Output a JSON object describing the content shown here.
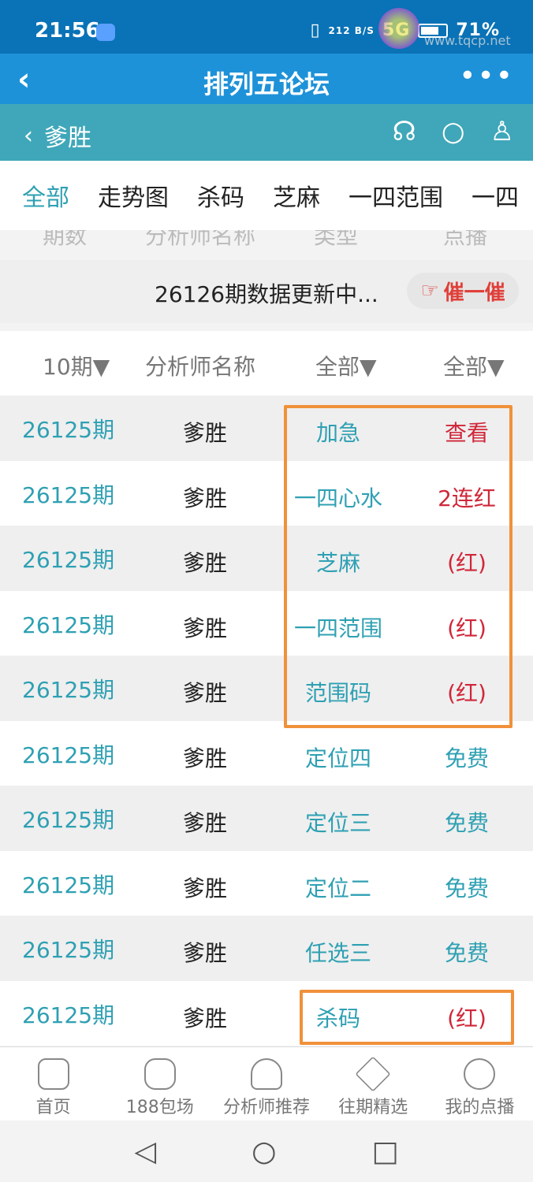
{
  "status": {
    "time": "21:56",
    "network": "212 B/S",
    "signal": "5G",
    "battery": "71%"
  },
  "header": {
    "title": "排列五论坛",
    "back_icon": "chevron-left-icon",
    "more_icon": "more-icon"
  },
  "subheader": {
    "name": "爹胜",
    "icons": [
      "headset-icon",
      "search-icon",
      "user-icon"
    ]
  },
  "tabs": [
    "全部",
    "走势图",
    "杀码",
    "芝麻",
    "一四范围",
    "一四"
  ],
  "ghost_header": [
    "期数",
    "分析师名称",
    "类型",
    "点播"
  ],
  "notice": {
    "text": "26126期数据更新中...",
    "urge_label": "催一催"
  },
  "filters": {
    "period": "10期▼",
    "analyst": "分析师名称",
    "type": "全部▼",
    "status": "全部▼"
  },
  "rows": [
    {
      "period": "26125期",
      "analyst": "爹胜",
      "type": "加急",
      "status": "查看",
      "red": true
    },
    {
      "period": "26125期",
      "analyst": "爹胜",
      "type": "一四心水",
      "status": "2连红",
      "red": true
    },
    {
      "period": "26125期",
      "analyst": "爹胜",
      "type": "芝麻",
      "status": "(红)",
      "red": true
    },
    {
      "period": "26125期",
      "analyst": "爹胜",
      "type": "一四范围",
      "status": "(红)",
      "red": true
    },
    {
      "period": "26125期",
      "analyst": "爹胜",
      "type": "范围码",
      "status": "(红)",
      "red": true
    },
    {
      "period": "26125期",
      "analyst": "爹胜",
      "type": "定位四",
      "status": "免费",
      "red": false
    },
    {
      "period": "26125期",
      "analyst": "爹胜",
      "type": "定位三",
      "status": "免费",
      "red": false
    },
    {
      "period": "26125期",
      "analyst": "爹胜",
      "type": "定位二",
      "status": "免费",
      "red": false
    },
    {
      "period": "26125期",
      "analyst": "爹胜",
      "type": "任选三",
      "status": "免费",
      "red": false
    },
    {
      "period": "26125期",
      "analyst": "爹胜",
      "type": "杀码",
      "status": "(红)",
      "red": true
    }
  ],
  "bottom_nav": [
    {
      "label": "首页",
      "icon": "home-icon"
    },
    {
      "label": "188包场",
      "icon": "crown-icon"
    },
    {
      "label": "分析师推荐",
      "icon": "analyst-icon"
    },
    {
      "label": "往期精选",
      "icon": "star-icon"
    },
    {
      "label": "我的点播",
      "icon": "profile-icon"
    }
  ],
  "watermark": "www.tqcp.net"
}
